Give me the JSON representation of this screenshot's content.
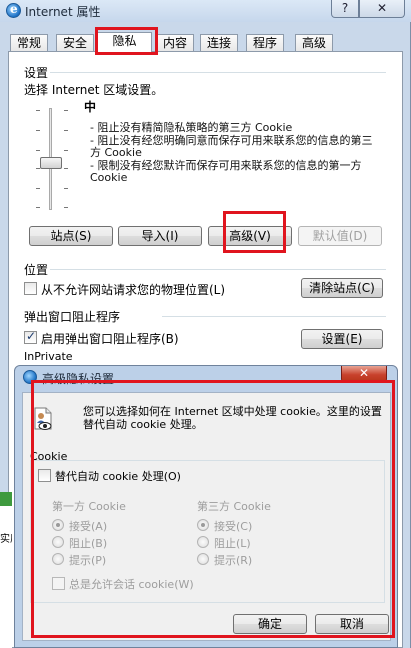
{
  "window": {
    "title": "Internet 属性",
    "help_label": "?",
    "close_label": "✕",
    "icon": "internet-explorer-icon"
  },
  "tabs": [
    {
      "label": "常规",
      "active": false
    },
    {
      "label": "安全",
      "active": false
    },
    {
      "label": "隐私",
      "active": true
    },
    {
      "label": "内容",
      "active": false
    },
    {
      "label": "连接",
      "active": false
    },
    {
      "label": "程序",
      "active": false
    },
    {
      "label": "高级",
      "active": false
    }
  ],
  "privacy": {
    "settings_header": "设置",
    "zone_instruction": "选择 Internet 区域设置。",
    "level_title": "中",
    "descriptions": [
      "- 阻止没有精简隐私策略的第三方 Cookie",
      "- 阻止没有经您明确同意而保存可用来联系您的信息的第三方 Cookie",
      "- 限制没有经您默许而保存可用来联系您的信息的第一方 Cookie"
    ],
    "buttons": {
      "sites": "站点(S)",
      "import": "导入(I)",
      "advanced": "高级(V)",
      "default": "默认值(D)"
    }
  },
  "location": {
    "header": "位置",
    "never_allow_label": "从不允许网站请求您的物理位置(L)",
    "never_allow_checked": false,
    "clear_sites_button": "清除站点(C)"
  },
  "popup": {
    "header": "弹出窗口阻止程序",
    "enable_label": "启用弹出窗口阻止程序(B)",
    "enable_checked": true,
    "settings_button": "设置(E)"
  },
  "inprivate": {
    "header": "InPrivate"
  },
  "advanced_dialog": {
    "title": "高级隐私设置",
    "close_label": "✕",
    "intro": "您可以选择如何在 Internet 区域中处理 cookie。这里的设置替代自动 cookie 处理。",
    "cookie_header": "Cookie",
    "override_label": "替代自动 cookie 处理(O)",
    "override_checked": false,
    "first_party": {
      "header": "第一方 Cookie",
      "options": [
        "接受(A)",
        "阻止(B)",
        "提示(P)"
      ],
      "selected": 0
    },
    "third_party": {
      "header": "第三方 Cookie",
      "options": [
        "接受(C)",
        "阻止(L)",
        "提示(R)"
      ],
      "selected": 0
    },
    "session_label": "总是允许会话 cookie(W)",
    "session_checked": false,
    "ok_button": "确定",
    "cancel_button": "取消"
  },
  "background_fragments": {
    "left_fragment": "实质"
  },
  "colors": {
    "highlight": "#e0141e",
    "window_frame": "#c9d8ea",
    "dialog_frame": "#bcd0e8"
  }
}
